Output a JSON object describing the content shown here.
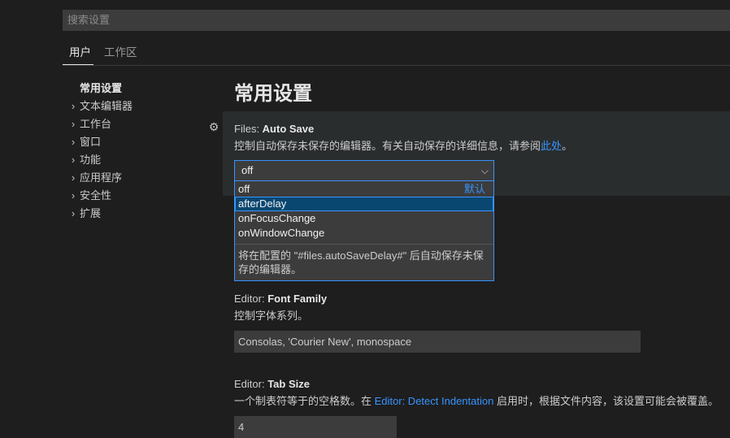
{
  "search": {
    "placeholder": "搜索设置"
  },
  "scope_tabs": [
    {
      "label": "用户"
    },
    {
      "label": "工作区"
    }
  ],
  "toc": {
    "active": "常用设置",
    "items": [
      {
        "label": "文本编辑器"
      },
      {
        "label": "工作台"
      },
      {
        "label": "窗口"
      },
      {
        "label": "功能"
      },
      {
        "label": "应用程序"
      },
      {
        "label": "安全性"
      },
      {
        "label": "扩展"
      }
    ]
  },
  "page_title": "常用设置",
  "auto_save": {
    "category": "Files: ",
    "name": "Auto Save",
    "description": "控制自动保存未保存的编辑器。有关自动保存的详细信息，请参阅",
    "link": "此处",
    "description_end": "。",
    "value": "off",
    "options": [
      {
        "label": "off",
        "tag": "默认"
      },
      {
        "label": "afterDelay"
      },
      {
        "label": "onFocusChange"
      },
      {
        "label": "onWindowChange"
      }
    ],
    "selected_option": "afterDelay",
    "option_description": "将在配置的 \"#files.autoSaveDelay#\" 后自动保存未保存的编辑器。"
  },
  "font_family": {
    "category": "Editor: ",
    "name": "Font Family",
    "description": "控制字体系列。",
    "value": "Consolas, 'Courier New', monospace"
  },
  "tab_size": {
    "category": "Editor: ",
    "name": "Tab Size",
    "description_pre": "一个制表符等于的空格数。在 ",
    "link": "Editor: Detect Indentation",
    "description_post": " 启用时，根据文件内容，该设置可能会被覆盖。",
    "value": "4"
  },
  "colors": {
    "background": "#1e1e1e",
    "input_background": "#3c3c3c",
    "focus_border": "#3794ff",
    "selected_option": "#094771",
    "link": "#3794ff"
  }
}
